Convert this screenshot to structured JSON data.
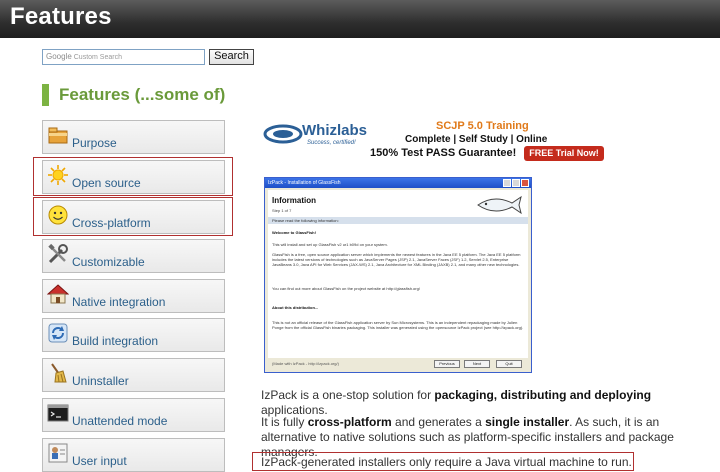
{
  "header": {
    "title": "Features"
  },
  "search": {
    "placeholder_prefix": "Google",
    "placeholder": "Custom Search",
    "button_label": "Search"
  },
  "section": {
    "title": "Features (...some of)"
  },
  "features": [
    {
      "label": "Purpose",
      "icon": "folder-icon"
    },
    {
      "label": "Open source",
      "icon": "sun-icon"
    },
    {
      "label": "Cross-platform",
      "icon": "smiley-icon"
    },
    {
      "label": "Customizable",
      "icon": "tools-icon"
    },
    {
      "label": "Native integration",
      "icon": "house-icon"
    },
    {
      "label": "Build integration",
      "icon": "refresh-icon"
    },
    {
      "label": "Uninstaller",
      "icon": "broom-icon"
    },
    {
      "label": "Unattended mode",
      "icon": "terminal-icon"
    },
    {
      "label": "User input",
      "icon": "user-form-icon"
    }
  ],
  "ad": {
    "brand": "Whizlabs",
    "tagline": "Success, certified!",
    "headline": "SCJP 5.0 Training",
    "subline": "Complete | Self Study | Online",
    "guarantee": "150% Test PASS Guarantee!",
    "cta": "FREE Trial Now!"
  },
  "installer": {
    "window_title": "IzPack - Installation of GlassFish",
    "heading": "Information",
    "step": "Step 1 of 7",
    "prompt": "Please read the following information:",
    "welcome": "Welcome to GlassFish!",
    "line1": "This will install and set up GlassFish v2 ur1 b09d on your system.",
    "line2": "GlassFish is a free, open source application server which implements the newest features in the Java EE 5 platform. The Java EE 5 platform includes the latest versions of technologies such as JavaServer Pages (JSP) 2.1, JavaServer Faces (JSF) 1.2, Servlet 2.5, Enterprise JavaBeans 3.0, Java API for Web Services (JAX-WS) 2.1, Java Architecture for XML Binding (JAXB) 2.1, and many other new technologies.",
    "line3": "You can find out more about GlassFish on the project website at http://glassfish.org/",
    "about": "About this distribution...",
    "line4": "This is not an official release of the GlassFish application server by Sun Microsystems. This is an independent repackaging made by Julien Ponge from the official GlassFish binaries packaging. This installer was generated using the opensource IzPack project (see http://izpack.org).",
    "footer": "(Made with IzPack - http://izpack.org/)",
    "btn_prev": "Previous",
    "btn_next": "Next",
    "btn_quit": "Quit"
  },
  "paragraphs": {
    "p1_a": "IzPack is a one-stop solution for ",
    "p1_b": "packaging, distributing and deploying",
    "p1_c": " applications.",
    "p2_a": "It is fully ",
    "p2_b": "cross-platform",
    "p2_c": " and generates a ",
    "p2_d": "single installer",
    "p2_e": ". As such, it is an alternative to native solutions such as platform-specific installers and package managers.",
    "p3": "IzPack-generated installers only require a Java virtual machine to run."
  }
}
